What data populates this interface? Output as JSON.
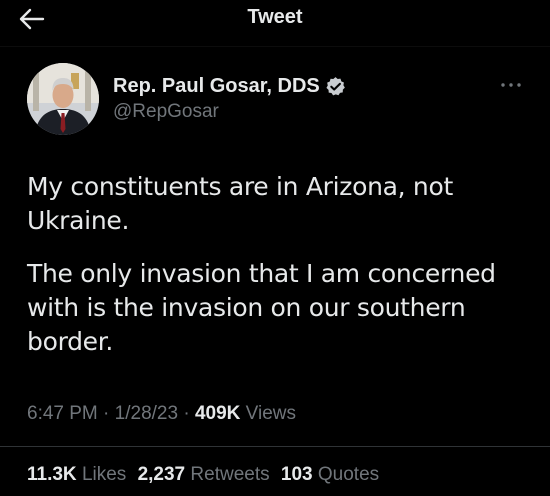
{
  "header": {
    "title": "Tweet",
    "back_icon": "arrow-left-icon"
  },
  "author": {
    "name": "Rep. Paul Gosar, DDS",
    "handle": "@RepGosar",
    "verified_icon": "verified-badge-icon",
    "verified_color": "#1d9bf0"
  },
  "more_icon": "more-horizontal-icon",
  "tweet": {
    "paragraphs": [
      "My constituents are in Arizona, not Ukraine.",
      "The only invasion that I am concerned with is the invasion on our southern border."
    ]
  },
  "meta": {
    "time": "6:47 PM",
    "separator": "·",
    "date": "1/28/23",
    "views_count": "409K",
    "views_label": "Views"
  },
  "stats": {
    "likes_count": "11.3K",
    "likes_label": "Likes",
    "retweets_count": "2,237",
    "retweets_label": "Retweets",
    "quotes_count": "103",
    "quotes_label": "Quotes"
  },
  "colors": {
    "background": "#000000",
    "primary_text": "#e7e9ea",
    "secondary_text": "#71767b",
    "divider": "#2f3336"
  }
}
